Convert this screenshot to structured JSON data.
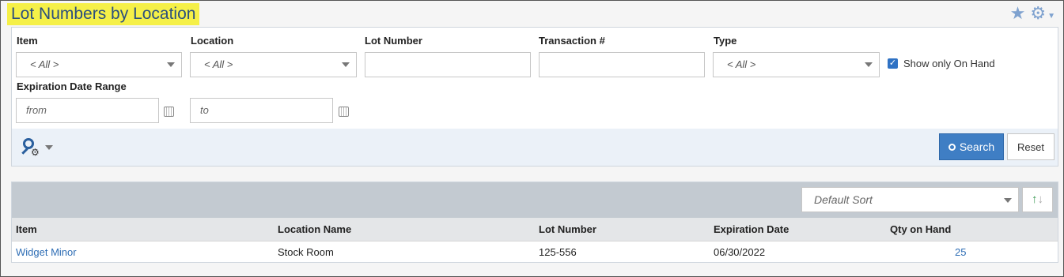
{
  "page": {
    "title": "Lot Numbers by Location"
  },
  "top_icons": {
    "favorite": "star-icon",
    "settings": "gear-icon"
  },
  "filters": {
    "item": {
      "label": "Item",
      "value": "< All >"
    },
    "location": {
      "label": "Location",
      "value": "< All >"
    },
    "lot_number": {
      "label": "Lot Number",
      "value": ""
    },
    "transaction": {
      "label": "Transaction #",
      "value": ""
    },
    "type": {
      "label": "Type",
      "value": "< All >"
    },
    "show_on_hand": {
      "label": "Show only On Hand",
      "checked": true
    },
    "expiration": {
      "label": "Expiration Date Range",
      "from_placeholder": "from",
      "to_placeholder": "to"
    }
  },
  "actions": {
    "search_label": "Search",
    "reset_label": "Reset"
  },
  "results": {
    "sort_placeholder": "Default Sort",
    "columns": [
      "Item",
      "Location Name",
      "Lot Number",
      "Expiration Date",
      "Qty on Hand"
    ],
    "rows": [
      {
        "item": "Widget Minor",
        "location": "Stock Room",
        "lot": "125-556",
        "expiration": "06/30/2022",
        "qty": "25"
      }
    ]
  },
  "colors": {
    "title_highlight": "#f5f048",
    "accent": "#3f7ec4",
    "link": "#2f6eb5"
  }
}
